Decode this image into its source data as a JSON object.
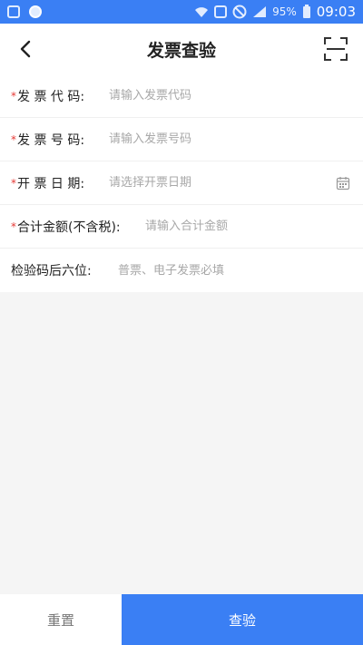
{
  "status_bar": {
    "battery": "95%",
    "time": "09:03",
    "left_icons": [
      "notes-icon",
      "app-icon"
    ],
    "right_icons": [
      "wifi-icon",
      "sim-icon",
      "dnd-icon",
      "signal-icon",
      "battery-icon"
    ]
  },
  "header": {
    "title": "发票查验",
    "back_icon": "back-arrow-icon",
    "scan_icon": "scan-icon"
  },
  "form": {
    "fields": [
      {
        "label": "发 票 代 码:",
        "required": true,
        "placeholder": "请输入发票代码",
        "value": ""
      },
      {
        "label": "发 票 号 码:",
        "required": true,
        "placeholder": "请输入发票号码",
        "value": ""
      },
      {
        "label": "开 票 日 期:",
        "required": true,
        "placeholder": "请选择开票日期",
        "value": "",
        "icon": "calendar-icon"
      },
      {
        "label": "合计金额(不含税):",
        "required": true,
        "placeholder": "请输入合计金额",
        "value": ""
      },
      {
        "label": "检验码后六位:",
        "required": false,
        "placeholder": "普票、电子发票必填",
        "value": ""
      }
    ],
    "required_mark": "*"
  },
  "actions": {
    "reset_label": "重置",
    "check_label": "查验"
  },
  "colors": {
    "accent": "#3a7ff4",
    "required": "#e53935",
    "background": "#f5f5f5"
  }
}
